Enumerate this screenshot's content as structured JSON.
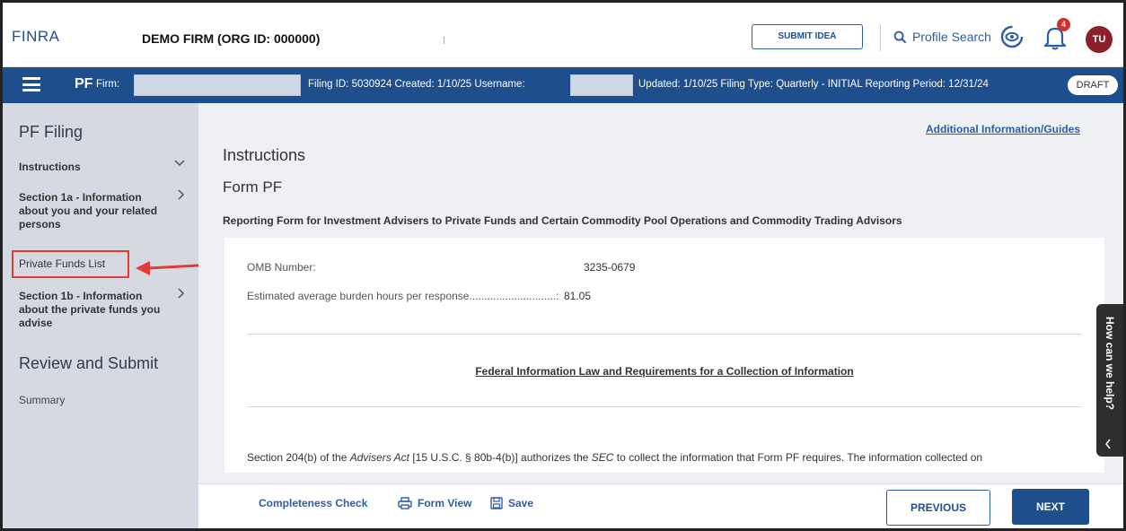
{
  "header": {
    "logo": "FINRA",
    "firm_name": "DEMO FIRM (ORG ID: 000000)",
    "submit_idea": "SUBMIT IDEA",
    "profile_search": "Profile Search",
    "notification_count": "4",
    "avatar_initials": "TU"
  },
  "filing_bar": {
    "pf": "PF",
    "firm_label": "Firm:",
    "filing_info": "Filing ID: 5030924  Created: 1/10/25  Username:",
    "updated_info": "Updated: 1/10/25  Filing Type: Quarterly - INITIAL  Reporting Period: 12/31/24",
    "status": "DRAFT"
  },
  "sidebar": {
    "title": "PF Filing",
    "instructions": "Instructions",
    "section_1a": "Section 1a - Information about you and your related persons",
    "private_funds_list": "Private Funds List",
    "section_1b": "Section 1b - Information about the private funds you advise",
    "review_title": "Review and Submit",
    "summary": "Summary"
  },
  "main": {
    "additional_info": "Additional Information/Guides",
    "heading": "Instructions",
    "form_heading": "Form PF",
    "subtitle": "Reporting Form for Investment Advisers to Private Funds and Certain Commodity Pool Operations and Commodity Trading Advisors",
    "omb_label": "OMB Number:",
    "omb_value": "3235-0679",
    "burden_label": "Estimated average burden hours per response.............................:",
    "burden_value": "81.05",
    "fed_title": "Federal Information Law and Requirements for a Collection of Information",
    "section_text_1": "Section 204(b) of the ",
    "section_text_act": "Advisers Act",
    "section_text_2": " [15 U.S.C. § 80b-4(b)] authorizes the ",
    "section_text_sec": "SEC",
    "section_text_3": " to collect the information that Form PF requires. The information collected on"
  },
  "footer": {
    "completeness_check": "Completeness Check",
    "form_view": "Form View",
    "save": "Save",
    "previous": "PREVIOUS",
    "next": "NEXT"
  },
  "help": {
    "label": "How can we help?"
  }
}
